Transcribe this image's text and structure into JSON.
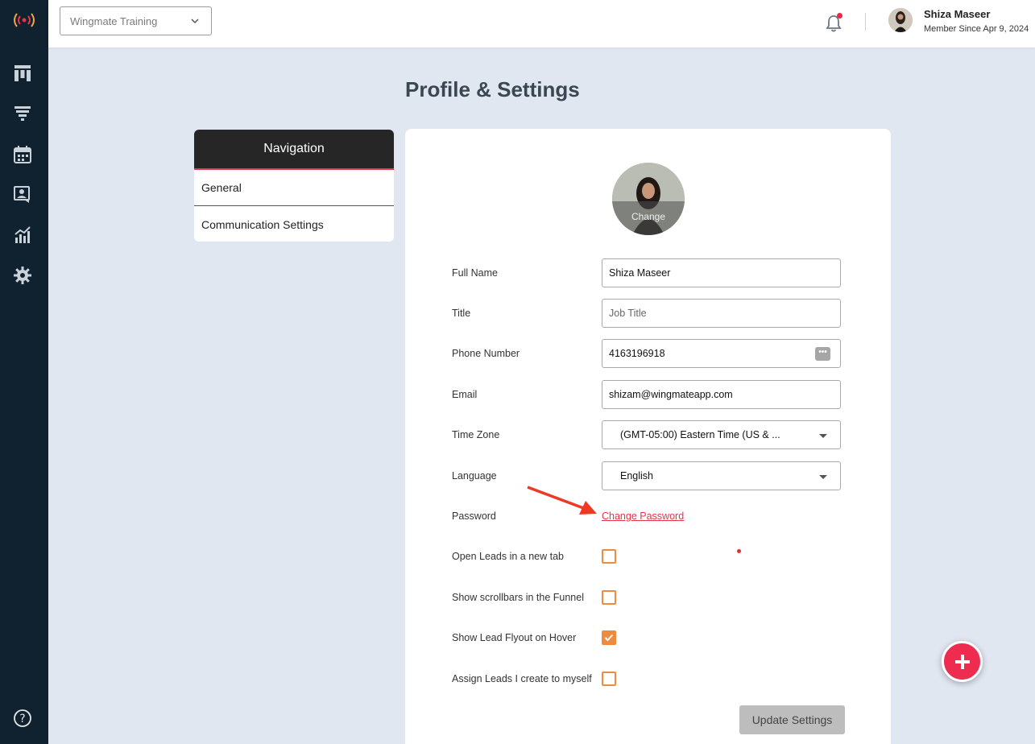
{
  "topbar": {
    "org_select_value": "Wingmate Training",
    "user_name": "Shiza Maseer",
    "member_since": "Member Since Apr 9, 2024"
  },
  "sidebar": {
    "items": [
      {
        "icon": "board-icon"
      },
      {
        "icon": "funnel-icon"
      },
      {
        "icon": "calendar-icon"
      },
      {
        "icon": "contacts-icon"
      },
      {
        "icon": "analytics-icon"
      },
      {
        "icon": "gear-icon"
      }
    ],
    "help_icon": "help-icon"
  },
  "page": {
    "title": "Profile & Settings"
  },
  "navigation": {
    "heading": "Navigation",
    "items": [
      "General",
      "Communication Settings"
    ]
  },
  "profile": {
    "photo_overlay": "Change",
    "fields": {
      "full_name": {
        "label": "Full Name",
        "value": "Shiza Maseer"
      },
      "title": {
        "label": "Title",
        "placeholder": "Job Title"
      },
      "phone": {
        "label": "Phone Number",
        "value": "4163196918"
      },
      "email": {
        "label": "Email",
        "value": "shizam@wingmateapp.com"
      },
      "time_zone": {
        "label": "Time Zone",
        "value": "(GMT-05:00) Eastern Time (US & ..."
      },
      "language": {
        "label": "Language",
        "value": "English"
      },
      "password": {
        "label": "Password",
        "link": "Change Password"
      }
    },
    "checkboxes": [
      {
        "label": "Open Leads in a new tab",
        "checked": false
      },
      {
        "label": "Show scrollbars in the Funnel",
        "checked": false
      },
      {
        "label": "Show Lead Flyout on Hover",
        "checked": true
      },
      {
        "label": "Assign Leads I create to myself",
        "checked": false
      }
    ],
    "update_button": "Update Settings"
  },
  "colors": {
    "sidebar_bg": "#102130",
    "accent": "#e8334a",
    "checkbox": "#f08a3e",
    "fab": "#ee2c50"
  }
}
